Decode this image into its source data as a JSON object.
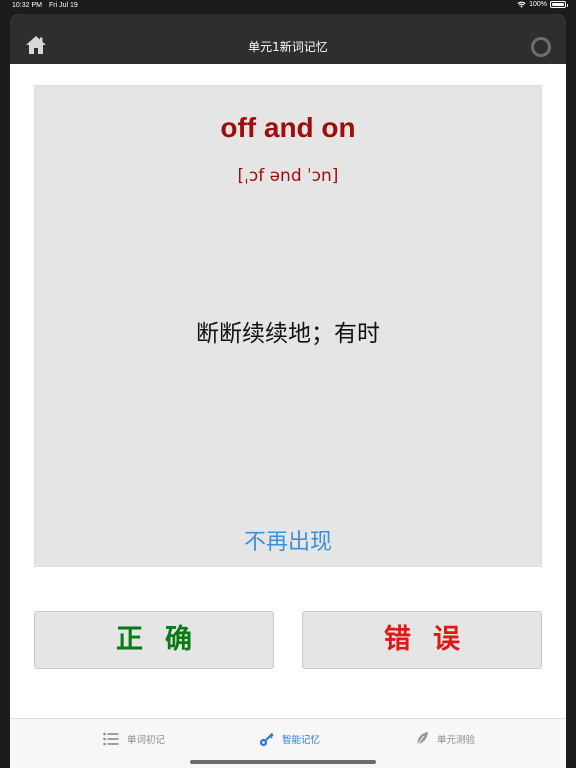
{
  "status_bar": {
    "time": "10:32 PM",
    "date": "Fri Jul 19",
    "battery": "100%"
  },
  "navbar": {
    "title": "单元1新词记忆",
    "home_icon": "home-icon",
    "sync_icon": "circle-icon"
  },
  "card": {
    "word": "off and on",
    "phonetic": "[ˌɔf ənd ˈɔn]",
    "meaning": "断断续续地；有时",
    "never_again": "不再出现"
  },
  "answers": {
    "correct_label": "正确",
    "wrong_label": "错误"
  },
  "tabs": [
    {
      "label": "单词初记",
      "icon": "list-icon",
      "active": false
    },
    {
      "label": "智能记忆",
      "icon": "key-icon",
      "active": true
    },
    {
      "label": "单元测验",
      "icon": "feather-icon",
      "active": false
    }
  ],
  "colors": {
    "word": "#a00b0b",
    "correct": "#0b7a14",
    "wrong": "#e01717",
    "link": "#3e8fd9",
    "active_tab": "#2f79d6"
  }
}
